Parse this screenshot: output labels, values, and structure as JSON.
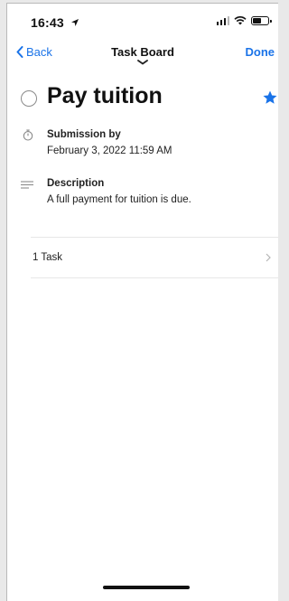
{
  "status_bar": {
    "time": "16:43",
    "location_icon": "location-arrow-icon",
    "signal_icon": "cellular-signal-icon",
    "wifi_icon": "wifi-icon",
    "battery_icon": "battery-icon",
    "battery_level": 0.5
  },
  "nav": {
    "back_label": "Back",
    "title": "Task Board",
    "done_label": "Done",
    "back_icon": "chevron-left-icon",
    "handle_icon": "pull-handle-icon"
  },
  "task": {
    "title": "Pay tuition",
    "completion_icon": "circle-checkbox-icon",
    "starred_icon": "star-icon",
    "starred": true
  },
  "submission": {
    "icon": "stopwatch-icon",
    "label": "Submission by",
    "value": "February 3, 2022 11:59 AM"
  },
  "description": {
    "icon": "text-lines-icon",
    "label": "Description",
    "value": "A full payment for tuition is due."
  },
  "subtasks": {
    "label": "1 Task",
    "chevron_icon": "chevron-right-icon"
  },
  "colors": {
    "accent": "#1a73e8",
    "text": "#111111",
    "secondary_icon": "#8a8a8a",
    "divider": "#e7e7e7"
  }
}
